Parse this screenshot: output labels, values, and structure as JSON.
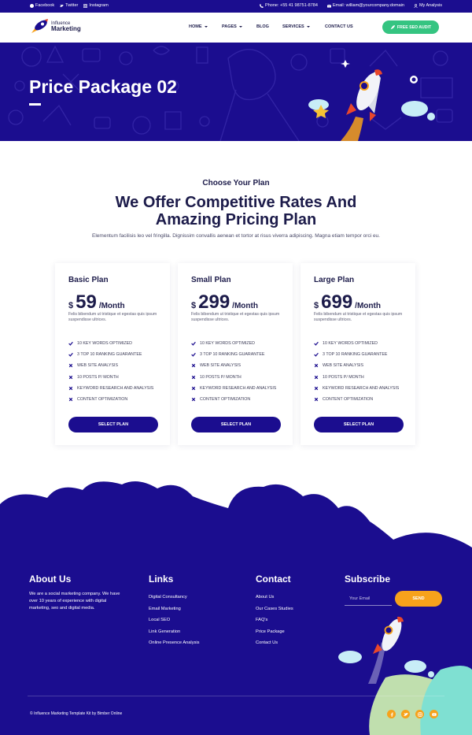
{
  "topbar": {
    "social": [
      {
        "label": "Facebook",
        "icon": "facebook-icon"
      },
      {
        "label": "Twitter",
        "icon": "twitter-icon"
      },
      {
        "label": "Instagram",
        "icon": "instagram-icon"
      }
    ],
    "phone": "Phone: +55 41 98751-8784",
    "email": "Email: william@yourcompany.domain",
    "account": "My Analysis"
  },
  "header": {
    "logo_line1": "Influence",
    "logo_line2": "Marketing",
    "nav": [
      {
        "label": "HOME",
        "dropdown": true
      },
      {
        "label": "PAGES",
        "dropdown": true
      },
      {
        "label": "BLOG",
        "dropdown": false
      },
      {
        "label": "SERVICES",
        "dropdown": true
      },
      {
        "label": "CONTACT US",
        "dropdown": false
      }
    ],
    "cta": "FREE SEO AUDIT"
  },
  "hero": {
    "title": "Price Package 02"
  },
  "intro": {
    "kicker": "Choose Your Plan",
    "heading_line1": "We Offer Competitive Rates And",
    "heading_line2": "Amazing Pricing Plan",
    "text": "Elementum facilisis leo vel fringilla. Dignissim convallis aenean et tortor at risus viverra adipiscing. Magna etiam tempor orci eu."
  },
  "plans": [
    {
      "name": "Basic Plan",
      "currency": "$",
      "amount": "59",
      "period": "/Month",
      "description": "Felis bibendum ut tristique et egestas quis ipsum suspendisse ultrices.",
      "features": [
        {
          "label": "10 KEY WORDS OPTIMIZED",
          "included": true
        },
        {
          "label": "3 TOP 10 RANKING GUARANTEE",
          "included": true
        },
        {
          "label": "WEB SITE ANALYSIS",
          "included": false
        },
        {
          "label": "10 POSTS P/ MONTH",
          "included": false
        },
        {
          "label": "KEYWORD RESEARCH AND ANALYSIS",
          "included": false
        },
        {
          "label": "CONTENT OPTIMIZATION",
          "included": false
        }
      ],
      "button": "SELECT PLAN"
    },
    {
      "name": "Small Plan",
      "currency": "$",
      "amount": "299",
      "period": "/Month",
      "description": "Felis bibendum ut tristique et egestas quis ipsum suspendisse ultrices.",
      "features": [
        {
          "label": "10 KEY WORDS OPTIMIZED",
          "included": true
        },
        {
          "label": "3 TOP 10 RANKING GUARANTEE",
          "included": true
        },
        {
          "label": "WEB SITE ANALYSIS",
          "included": false
        },
        {
          "label": "10 POSTS P/ MONTH",
          "included": false
        },
        {
          "label": "KEYWORD RESEARCH AND ANALYSIS",
          "included": false
        },
        {
          "label": "CONTENT OPTIMIZATION",
          "included": false
        }
      ],
      "button": "SELECT PLAN"
    },
    {
      "name": "Large Plan",
      "currency": "$",
      "amount": "699",
      "period": "/Month",
      "description": "Felis bibendum ut tristique et egestas quis ipsum suspendisse ultrices.",
      "features": [
        {
          "label": "10 KEY WORDS OPTIMIZED",
          "included": true
        },
        {
          "label": "3 TOP 10 RANKING GUARANTEE",
          "included": true
        },
        {
          "label": "WEB SITE ANALYSIS",
          "included": false
        },
        {
          "label": "10 POSTS P/ MONTH",
          "included": false
        },
        {
          "label": "KEYWORD RESEARCH AND ANALYSIS",
          "included": false
        },
        {
          "label": "CONTENT OPTIMIZATION",
          "included": false
        }
      ],
      "button": "SELECT PLAN"
    }
  ],
  "footer": {
    "about_title": "About Us",
    "about_text": "We are a social marketing company. We have over 10 years of experience with digital marketing, seo and digital media.",
    "links_title": "Links",
    "links": [
      "Digital Consultancy",
      "Email Marketing",
      "Local SEO",
      "Link Generation",
      "Online Presence Analysis"
    ],
    "contact_title": "Contact",
    "contact_links": [
      "About Us",
      "Our Cases Studies",
      "FAQ's",
      "Price Package",
      "Contact Us"
    ],
    "subscribe_title": "Subscribe",
    "email_placeholder": "Your Email",
    "send_label": "SEND",
    "copyright": "© Influence Marketing Template Kit by Bimber Online",
    "socials": [
      "facebook-icon",
      "twitter-icon",
      "instagram-icon",
      "youtube-icon"
    ]
  },
  "colors": {
    "brand_navy": "#1b0d8f",
    "accent_green": "#35c481",
    "accent_orange": "#f7a21b",
    "text_dark": "#1c1b4a"
  }
}
